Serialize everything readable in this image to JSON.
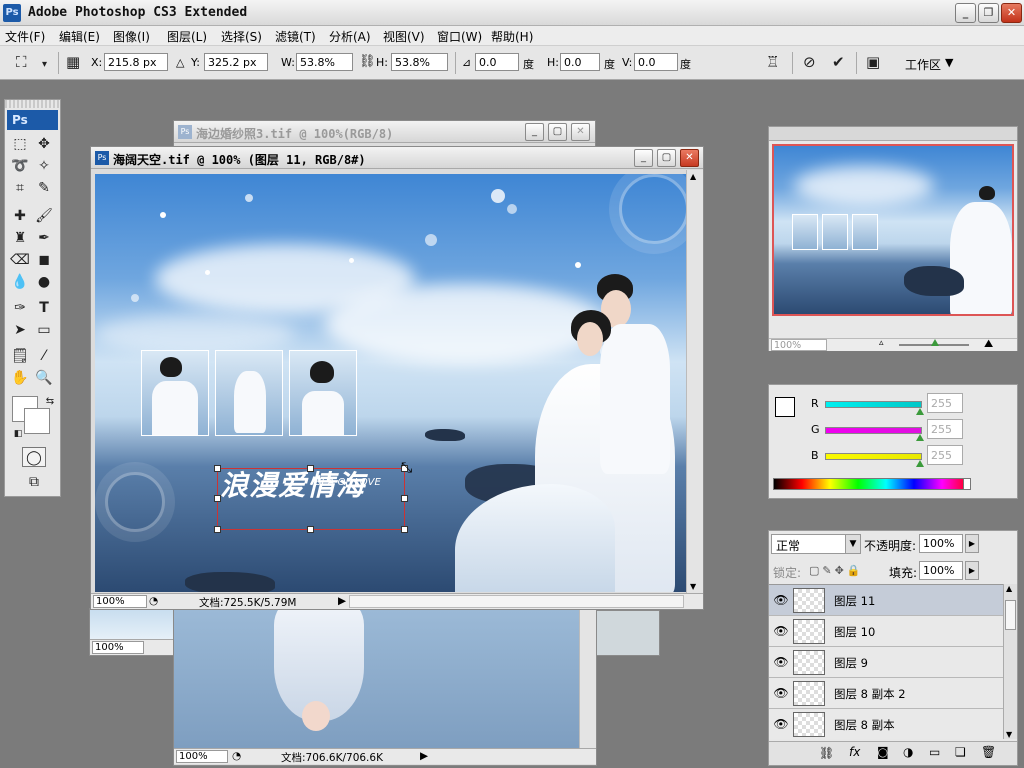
{
  "app": {
    "icon_text": "Ps",
    "title": "Adobe Photoshop CS3 Extended"
  },
  "window_controls": {
    "minimize": "_",
    "maximize": "❐",
    "close": "✕"
  },
  "menu": [
    "文件(F)",
    "编辑(E)",
    "图像(I)",
    "图层(L)",
    "选择(S)",
    "滤镜(T)",
    "分析(A)",
    "视图(V)",
    "窗口(W)",
    "帮助(H)"
  ],
  "options_bar": {
    "x_label": "X:",
    "x_value": "215.8 px",
    "y_label": "Y:",
    "y_value": "325.2 px",
    "w_label": "W:",
    "w_value": "53.8%",
    "h_label": "H:",
    "h_value": "53.8%",
    "angle_value": "0.0",
    "angle_unit": "度",
    "hskew_label": "H:",
    "hskew_value": "0.0",
    "hskew_unit": "度",
    "vskew_label": "V:",
    "vskew_value": "0.0",
    "vskew_unit": "度",
    "workspace": "工作区"
  },
  "toolbox": {
    "logo": "Ps"
  },
  "documents": {
    "back1": {
      "title": "海边婚纱照3.tif @ 100%(RGB/8)",
      "zoom": "100%"
    },
    "front": {
      "title": "海阔天空.tif @ 100% (图层 11, RGB/8#)",
      "zoom": "100%",
      "status": "文档:725.5K/5.79M",
      "logo_text": "浪漫爱情海",
      "logo_sub": "SEA OF LOVE"
    },
    "back2": {
      "zoom": "100%",
      "status": "文档:706.6K/706.6K"
    },
    "back3": {
      "zoom": "100%"
    }
  },
  "navigator": {
    "zoom": "100%"
  },
  "color_panel": {
    "channels": [
      {
        "label": "R",
        "value": "255",
        "color": "#00c8c8"
      },
      {
        "label": "G",
        "value": "255",
        "color": "#e010e0"
      },
      {
        "label": "B",
        "value": "255",
        "color": "#e8e800"
      }
    ]
  },
  "layers_panel": {
    "blend_mode": "正常",
    "opacity_label": "不透明度:",
    "opacity_value": "100%",
    "lock_label": "锁定:",
    "fill_label": "填充:",
    "fill_value": "100%",
    "layers": [
      {
        "name": "图层 11",
        "selected": true
      },
      {
        "name": "图层 10",
        "selected": false
      },
      {
        "name": "图层 9",
        "selected": false
      },
      {
        "name": "图层 8 副本 2",
        "selected": false
      },
      {
        "name": "图层 8 副本",
        "selected": false
      }
    ]
  }
}
